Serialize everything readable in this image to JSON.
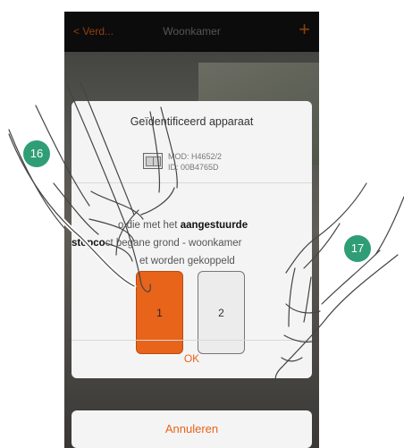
{
  "header": {
    "back_label": "< Verd...",
    "title": "Woonkamer",
    "add_label": "+"
  },
  "dialog": {
    "title": "Geïdentificeerd apparaat",
    "device_model": "MOD: H4652/2",
    "device_id": "ID: 00B4765D",
    "message_part1": "o die met het ",
    "message_bold1": "aangestuurde",
    "message_bold2": "stopco",
    "message_part2": "ct begane grond - woonkamer",
    "message_part3": "et worden gekoppeld",
    "channels": [
      "1",
      "2"
    ],
    "selected_channel": "1",
    "ok_label": "OK"
  },
  "cancel_label": "Annuleren",
  "step_markers": [
    "16",
    "17"
  ],
  "colors": {
    "accent": "#e8641a",
    "step_marker": "#2f9e77"
  }
}
